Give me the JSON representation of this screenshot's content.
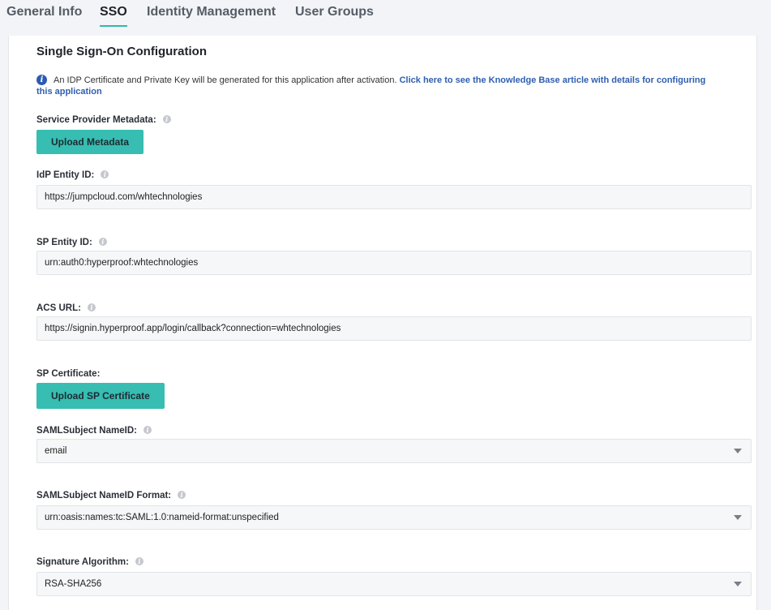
{
  "tabs": [
    {
      "label": "General Info",
      "active": false
    },
    {
      "label": "SSO",
      "active": true
    },
    {
      "label": "Identity Management",
      "active": false
    },
    {
      "label": "User Groups",
      "active": false
    }
  ],
  "section": {
    "title": "Single Sign-On Configuration",
    "info_text": "An IDP Certificate and Private Key will be generated for this application after activation.",
    "info_link_line1": "Click here to see the Knowledge Base article with details for configuring",
    "info_link_line2": "this application"
  },
  "sp_metadata": {
    "label": "Service Provider Metadata:",
    "button_label": "Upload Metadata"
  },
  "idp_entity_id": {
    "label": "IdP Entity ID:",
    "value": "https://jumpcloud.com/whtechnologies"
  },
  "sp_entity_id": {
    "label": "SP Entity ID:",
    "value": "urn:auth0:hyperproof:whtechnologies"
  },
  "acs_url": {
    "label": "ACS URL:",
    "value": "https://signin.hyperproof.app/login/callback?connection=whtechnologies"
  },
  "sp_certificate": {
    "label": "SP Certificate:",
    "button_label": "Upload SP Certificate"
  },
  "saml_subject_nameid": {
    "label": "SAMLSubject NameID:",
    "value": "email"
  },
  "saml_subject_nameid_format": {
    "label": "SAMLSubject NameID Format:",
    "value": "urn:oasis:names:tc:SAML:1.0:nameid-format:unspecified"
  },
  "signature_algorithm": {
    "label": "Signature Algorithm:",
    "value": "RSA-SHA256"
  },
  "colors": {
    "accent": "#37bdb1",
    "link": "#2f5fb0",
    "info_icon": "#2c5bb3"
  }
}
